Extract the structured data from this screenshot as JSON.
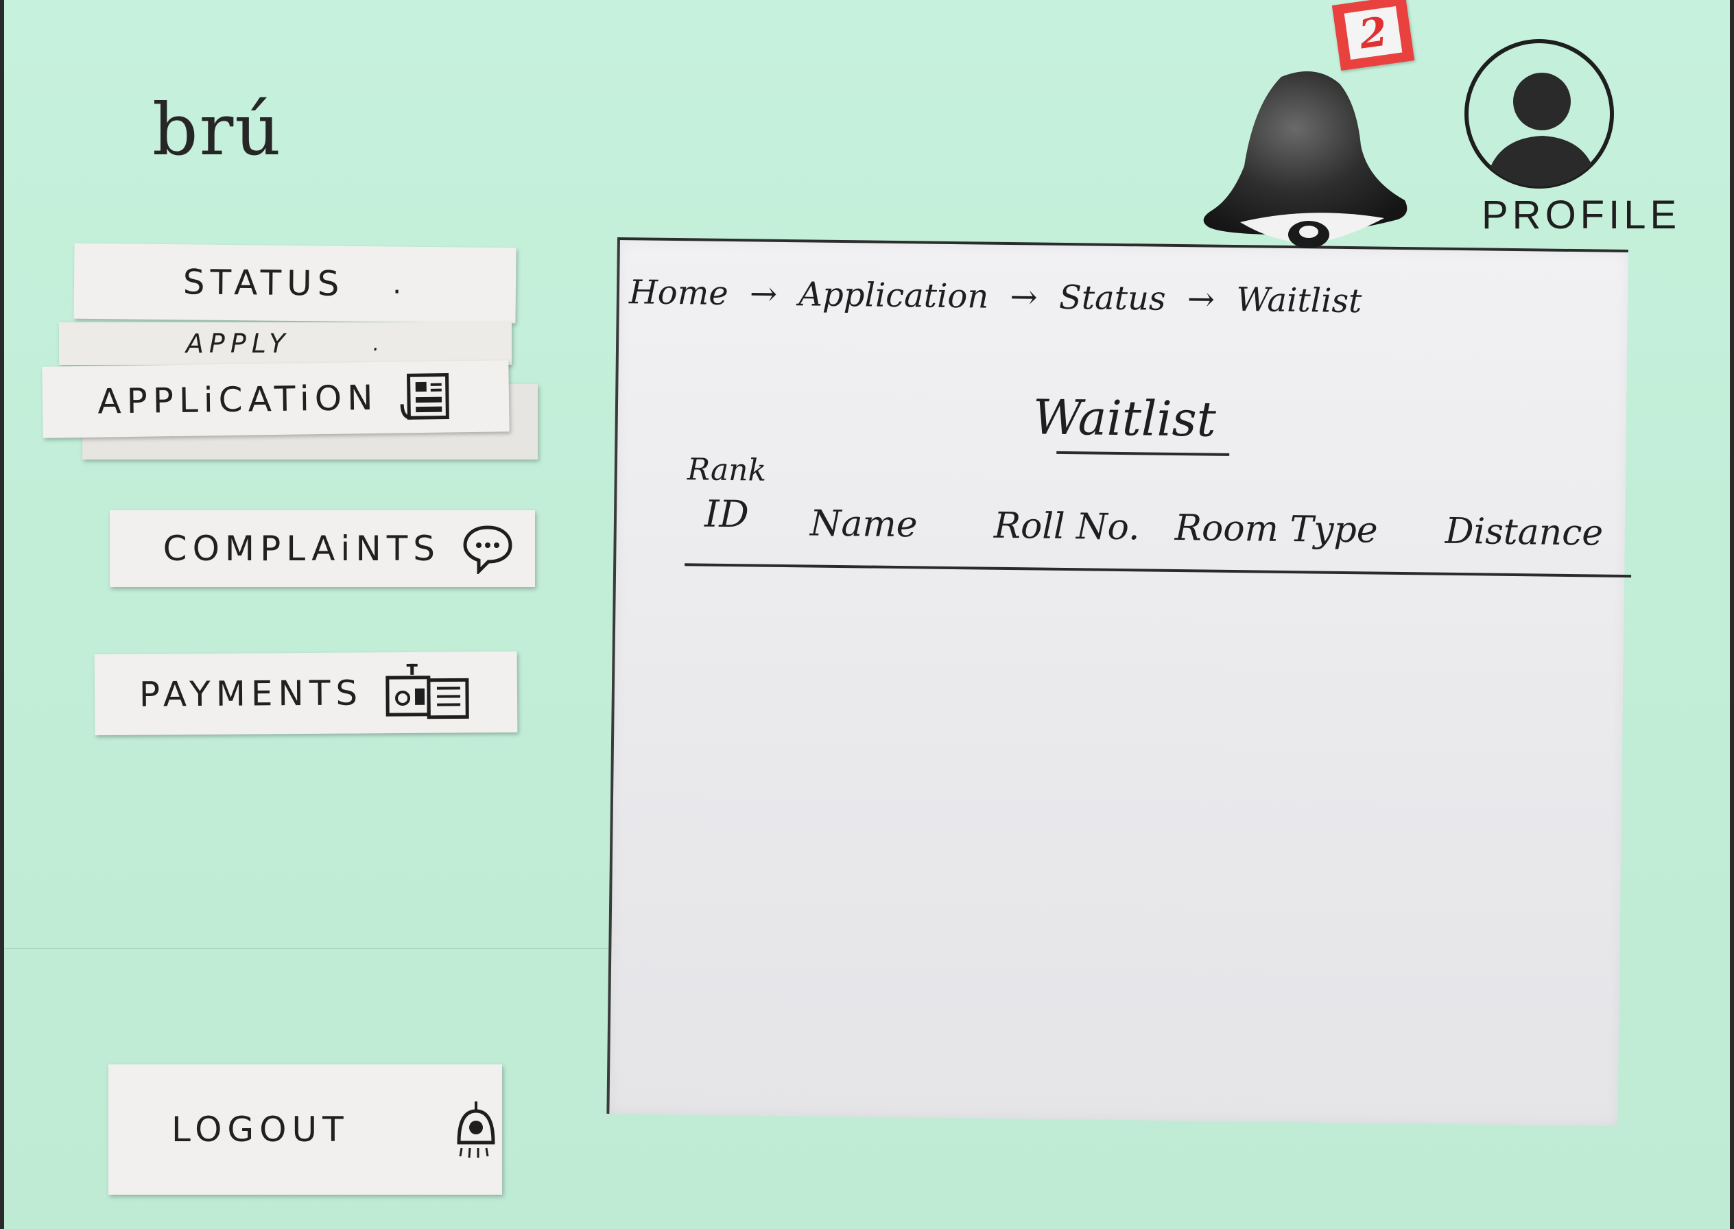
{
  "app": {
    "logo": "brú"
  },
  "sidebar": {
    "items": [
      {
        "label": "STATUS",
        "suffix": "."
      },
      {
        "label": "APPLY",
        "suffix": "."
      },
      {
        "label": "APPLiCATiON",
        "icon": "application-form-icon"
      },
      {
        "label": "COMPLAiNTS",
        "icon": "speech-bubble-icon"
      },
      {
        "label": "PAYMENTS",
        "icon": "payment-icon"
      },
      {
        "label": "LOGOUT",
        "icon": "logout-icon"
      }
    ]
  },
  "header": {
    "notifications": {
      "count": "2",
      "icon": "bell-icon"
    },
    "profile": {
      "label": "PROFILE",
      "icon": "avatar-icon"
    }
  },
  "main": {
    "breadcrumb": [
      {
        "label": "Home"
      },
      {
        "label": "Application"
      },
      {
        "label": "Status"
      },
      {
        "label": "Waitlist"
      }
    ],
    "breadcrumb_separator": "→",
    "title": "Waitlist",
    "table": {
      "columns": [
        "Rank",
        "ID",
        "Name",
        "Roll No.",
        "Room Type",
        "Distance"
      ]
    }
  },
  "colors": {
    "background": "#c4efda",
    "card": "#f1f0ee",
    "panel": "#eeeef0",
    "badge": "#e8413e",
    "ink": "#1e1e1e"
  }
}
